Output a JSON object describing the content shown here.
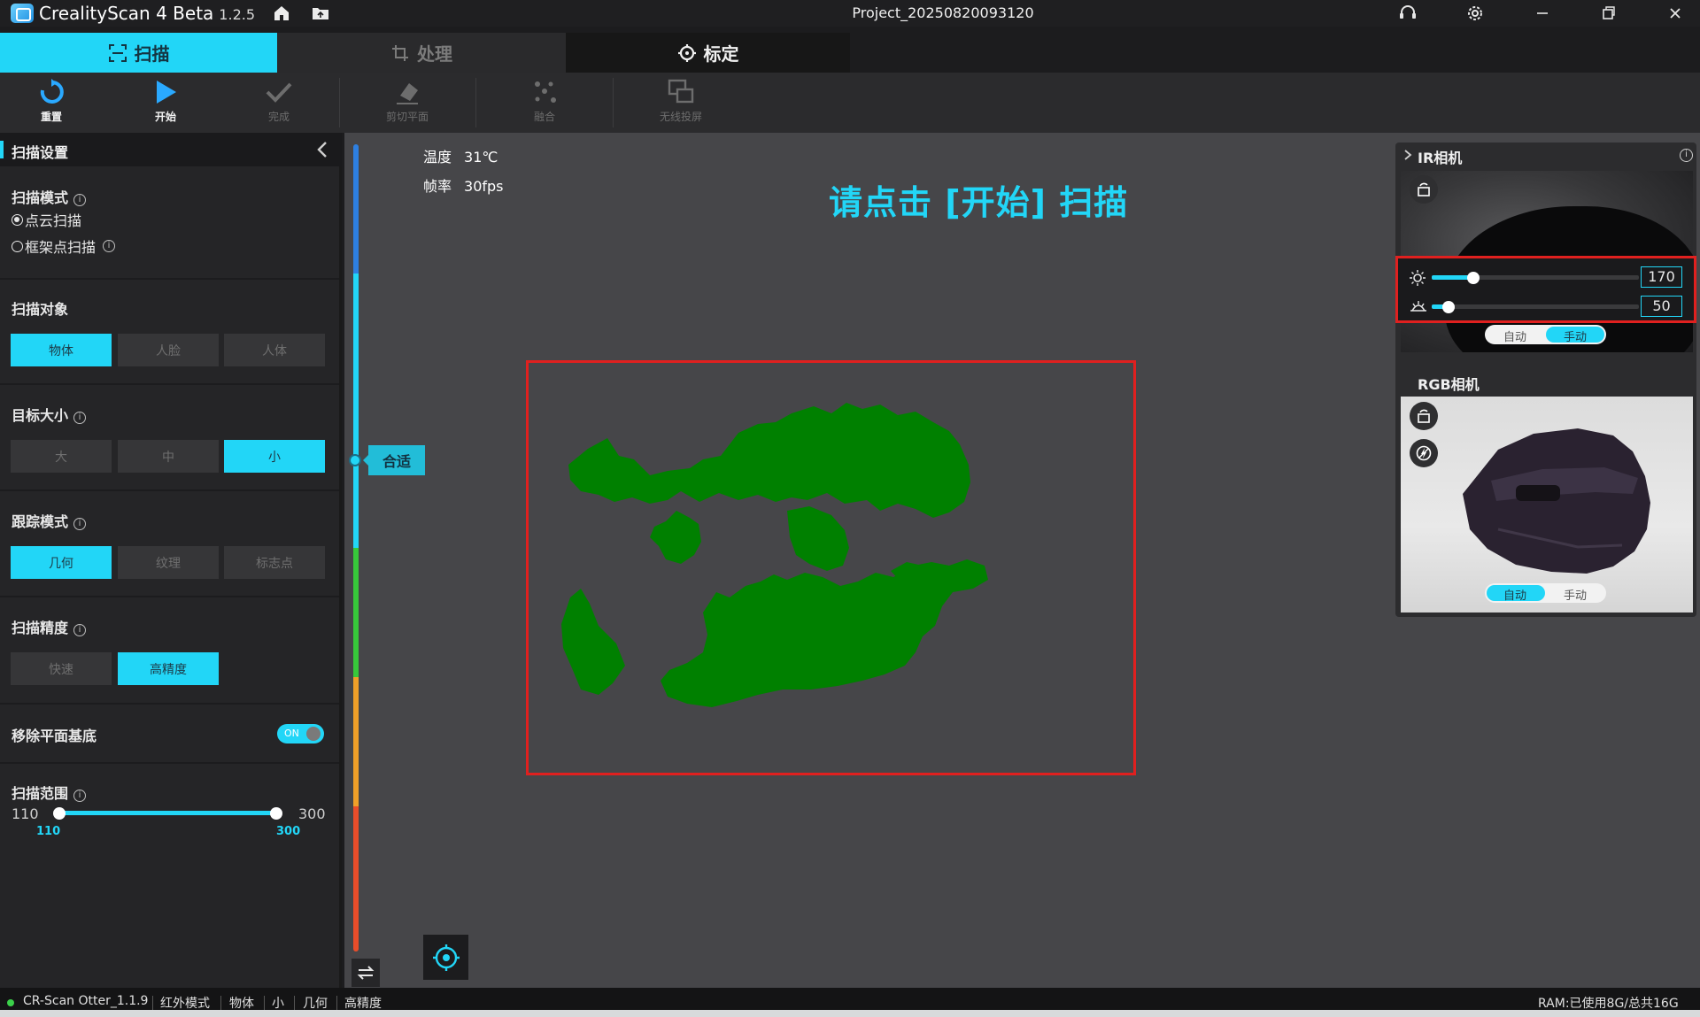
{
  "app": {
    "name": "CrealityScan 4 Beta",
    "version": "1.2.5",
    "project_title": "Project_20250820093120"
  },
  "tabs": [
    {
      "label": "扫描",
      "icon": "scan-frame-icon",
      "state": "active"
    },
    {
      "label": "处理",
      "icon": "crop-icon",
      "state": "disabled"
    },
    {
      "label": "标定",
      "icon": "crosshair-icon",
      "state": "normal"
    }
  ],
  "toolbar": [
    {
      "label": "重置",
      "icon": "reset-icon",
      "enabled": true
    },
    {
      "label": "开始",
      "icon": "play-icon",
      "enabled": true
    },
    {
      "label": "完成",
      "icon": "check-icon",
      "enabled": false
    },
    {
      "label": "剪切平面",
      "icon": "eraser-icon",
      "enabled": false
    },
    {
      "label": "融合",
      "icon": "fuse-icon",
      "enabled": false
    },
    {
      "label": "无线投屏",
      "icon": "cast-icon",
      "enabled": false
    }
  ],
  "scan_settings": {
    "header": "扫描设置",
    "scan_mode": {
      "title": "扫描模式",
      "options": [
        "点云扫描",
        "框架点扫描"
      ],
      "selected": "点云扫描"
    },
    "scan_object": {
      "title": "扫描对象",
      "options": [
        "物体",
        "人脸",
        "人体"
      ],
      "selected": "物体"
    },
    "target_size": {
      "title": "目标大小",
      "options": [
        "大",
        "中",
        "小"
      ],
      "selected": "小"
    },
    "tracking_mode": {
      "title": "跟踪模式",
      "options": [
        "几何",
        "纹理",
        "标志点"
      ],
      "selected": "几何"
    },
    "precision": {
      "title": "扫描精度",
      "options": [
        "快速",
        "高精度"
      ],
      "selected": "高精度"
    },
    "remove_plane": {
      "title": "移除平面基底",
      "toggle_label": "ON",
      "value": true
    },
    "scan_range": {
      "title": "扫描范围",
      "min_label": "110",
      "max_label": "300",
      "low_value": "110",
      "high_value": "300"
    }
  },
  "viewport": {
    "temperature_label": "温度",
    "temperature_value": "31℃",
    "framerate_label": "帧率",
    "framerate_value": "30fps",
    "prompt": "请点击 [开始] 扫描",
    "distance_status": "合适",
    "colors": {
      "point_cloud": "#008000",
      "highlight_box": "#e0201f",
      "accent": "#22d6f7"
    }
  },
  "camera_panel": {
    "ir": {
      "title": "IR相机",
      "brightness_value": "170",
      "brightness_level": 0.2,
      "exposure_value": "50",
      "exposure_level": 0.08,
      "mode_options": [
        "自动",
        "手动"
      ],
      "mode_selected": "手动"
    },
    "rgb": {
      "title": "RGB相机",
      "mode_options": [
        "自动",
        "手动"
      ],
      "mode_selected": "自动"
    }
  },
  "status_bar": {
    "device": "CR-Scan Otter_1.1.9",
    "items": [
      "红外模式",
      "物体",
      "小",
      "几何",
      "高精度"
    ],
    "ram": "RAM:已使用8G/总共16G"
  }
}
